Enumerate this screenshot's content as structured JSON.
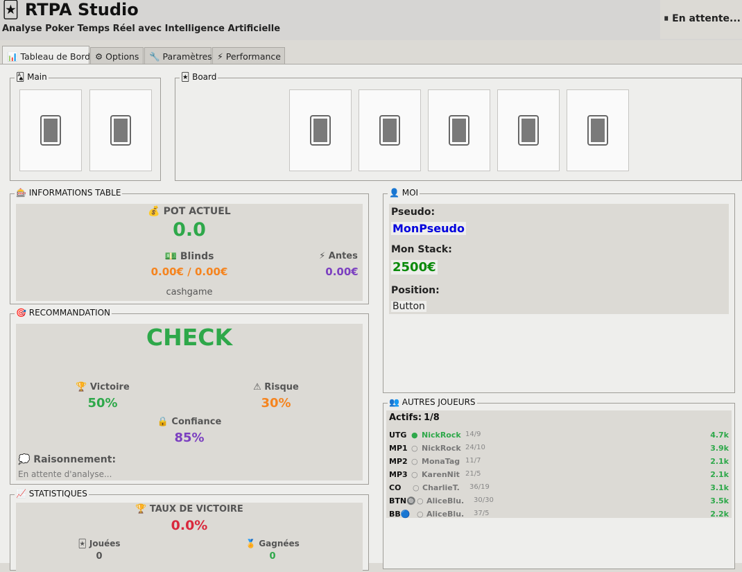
{
  "header": {
    "title": "🃏 RTPA Studio",
    "subtitle": "Analyse Poker Temps Réel avec Intelligence Artificielle",
    "status": "⏸ En attente..."
  },
  "tabs": [
    {
      "label": "📊 Tableau de Bord",
      "active": true
    },
    {
      "label": "⚙ Options"
    },
    {
      "label": "🔧 Paramètres"
    },
    {
      "label": "⚡ Performance"
    }
  ],
  "main": {
    "hand": {
      "legend": "🂡 Main"
    },
    "board": {
      "legend": "🃏 Board"
    }
  },
  "table_info": {
    "legend": "🎰 INFORMATIONS TABLE",
    "pot_label": "💰 POT ACTUEL",
    "pot_value": "0.0",
    "blinds_label": "💵 Blinds",
    "blinds_value": "0.00€ / 0.00€",
    "antes_label": "⚡ Antes",
    "antes_value": "0.00€",
    "game_type": "cashgame"
  },
  "recommendation": {
    "legend": "🎯 RECOMMANDATION",
    "action": "CHECK",
    "win_label": "🏆 Victoire",
    "win_value": "50%",
    "risk_label": "⚠ Risque",
    "risk_value": "30%",
    "confidence_label": "🔒 Confiance",
    "confidence_value": "85%",
    "reasoning_label": "💭 Raisonnement:",
    "reasoning_text": "En attente d'analyse..."
  },
  "statistics": {
    "legend": "📈 STATISTIQUES",
    "win_rate_label": "🏆 TAUX DE VICTOIRE",
    "win_rate_value": "0.0%",
    "played_label": "🃏 Jouées",
    "played_value": "0",
    "won_label": "🏅 Gagnées",
    "won_value": "0"
  },
  "me": {
    "legend": "👤 MOI",
    "pseudo_label": "Pseudo:",
    "pseudo_value": "MonPseudo",
    "stack_label": "Mon Stack:",
    "stack_value": "2500€",
    "position_label": "Position:",
    "position_value": "Button"
  },
  "others": {
    "legend": "👥 AUTRES JOUEURS",
    "actifs_label": "Actifs:",
    "actifs_value": "1/8",
    "players": [
      {
        "pos": "UTG",
        "dot": "●",
        "name": "NickRock",
        "stats": "14/9",
        "stack": "4.7k",
        "active": true
      },
      {
        "pos": "MP1",
        "dot": "○",
        "name": "NickRock",
        "stats": "24/10",
        "stack": "3.9k",
        "active": false
      },
      {
        "pos": "MP2",
        "dot": "○",
        "name": "MonaTag",
        "stats": "11/7",
        "stack": "2.1k",
        "active": false
      },
      {
        "pos": "MP3",
        "dot": "○",
        "name": "KarenNit",
        "stats": "21/5",
        "stack": "2.1k",
        "active": false
      },
      {
        "pos": "CO",
        "dot": "○",
        "name": "CharlieT.",
        "stats": "36/19",
        "stack": "3.1k",
        "active": false
      },
      {
        "pos": "BTN🔘",
        "dot": "○",
        "name": "AliceBlu.",
        "stats": "30/30",
        "stack": "3.5k",
        "active": false
      },
      {
        "pos": "BB🔵",
        "dot": "○",
        "name": "AliceBlu.",
        "stats": "37/5",
        "stack": "2.2k",
        "active": false
      }
    ]
  },
  "colors": {
    "green": "#2ea84a",
    "orange": "#f5841f",
    "purple": "#7b3fc0",
    "red": "#d9283c",
    "blue": "#0000dd",
    "dark_green": "#0a8a0a"
  }
}
